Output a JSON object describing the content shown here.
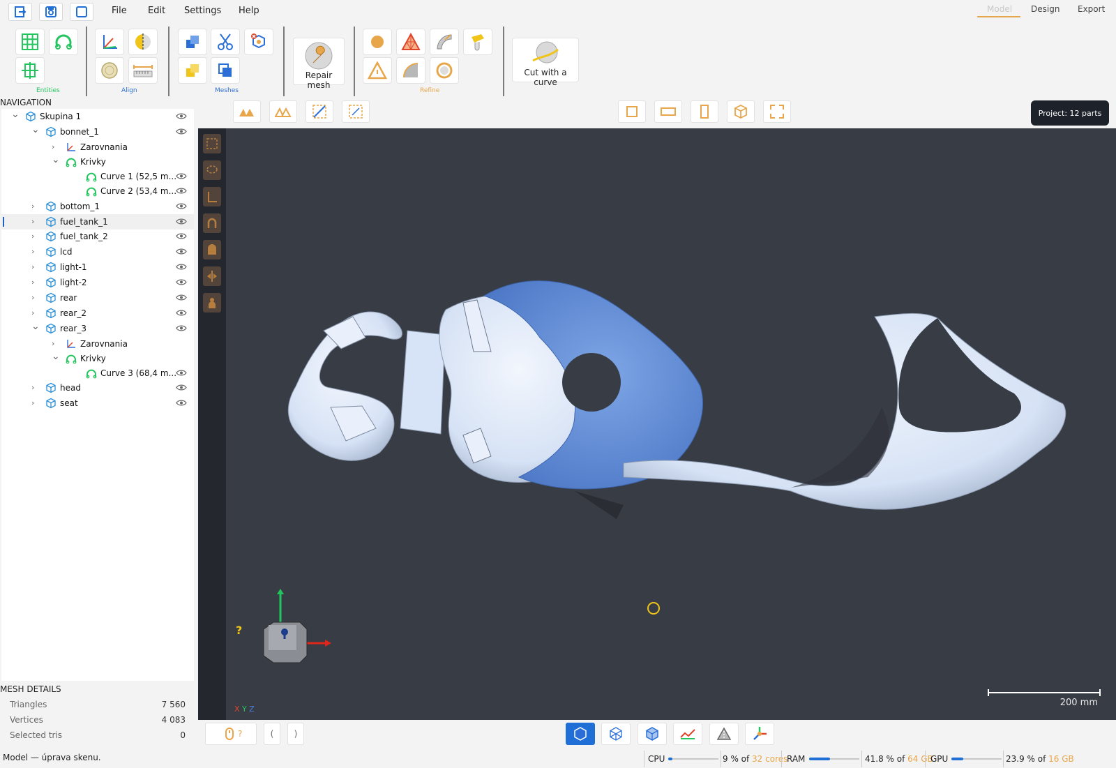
{
  "menu": {
    "file": "File",
    "edit": "Edit",
    "settings": "Settings",
    "help": "Help"
  },
  "mode_tabs": {
    "model": "Model",
    "design": "Design",
    "export": "Export"
  },
  "ribbon": {
    "groups": {
      "entities": "Entities",
      "align": "Align",
      "meshes": "Meshes",
      "refine": "Refine"
    },
    "repair_mesh": "Repair mesh",
    "cut_with_curve": "Cut with a curve"
  },
  "project_badge": "Project: 12 parts",
  "navigation": {
    "title": "NAVIGATION",
    "rows": [
      {
        "label": "Skupina 1",
        "chevron": "v"
      },
      {
        "label": "bonnet_1",
        "chevron": "v"
      },
      {
        "label": "Zarovnania",
        "chevron": ">"
      },
      {
        "label": "Krivky",
        "chevron": "v"
      },
      {
        "label": "Curve 1  (52,5 m...",
        "chevron": ""
      },
      {
        "label": "Curve 2  (53,4 m...",
        "chevron": ""
      },
      {
        "label": "bottom_1",
        "chevron": ">"
      },
      {
        "label": "fuel_tank_1",
        "chevron": ">"
      },
      {
        "label": "fuel_tank_2",
        "chevron": ">"
      },
      {
        "label": "lcd",
        "chevron": ">"
      },
      {
        "label": "light-1",
        "chevron": ">"
      },
      {
        "label": "light-2",
        "chevron": ">"
      },
      {
        "label": "rear",
        "chevron": ">"
      },
      {
        "label": "rear_2",
        "chevron": ">"
      },
      {
        "label": "rear_3",
        "chevron": "v"
      },
      {
        "label": "Zarovnania",
        "chevron": ">"
      },
      {
        "label": "Krivky",
        "chevron": "v"
      },
      {
        "label": "Curve 3  (68,4 m...",
        "chevron": ""
      },
      {
        "label": "head",
        "chevron": ">"
      },
      {
        "label": "seat",
        "chevron": ">"
      }
    ]
  },
  "mesh_details": {
    "title": "MESH DETAILS",
    "triangles_label": "Triangles",
    "triangles": "7 560",
    "vertices_label": "Vertices",
    "vertices": "4 083",
    "selected_label": "Selected tris",
    "selected": "0"
  },
  "viewport": {
    "help": "?",
    "scale_label": "200 mm",
    "axis_x": "X",
    "axis_y": "Y",
    "axis_z": "Z"
  },
  "bottom": {
    "mouse_hint": "?",
    "bracket_left": "(",
    "bracket_right": ")"
  },
  "status": "Model — úprava skenu.",
  "resources": {
    "cpu_label": "CPU",
    "cpu_value": "9 % of ",
    "cpu_total": "32 cores",
    "cpu_usage": 0.09,
    "ram_label": "RAM",
    "ram_value": "41.8 % of ",
    "ram_total": "64 GB",
    "ram_usage": 0.418,
    "gpu_label": "GPU",
    "gpu_value": "23.9 % of ",
    "gpu_total": "16 GB",
    "gpu_usage": 0.239
  },
  "colors": {
    "accent": "#1f6fd6",
    "orange": "#e8a64a",
    "green": "#22c55e",
    "viewport": "#383c45",
    "part_selected": "#6b97e0",
    "part": "#dde7f7"
  }
}
